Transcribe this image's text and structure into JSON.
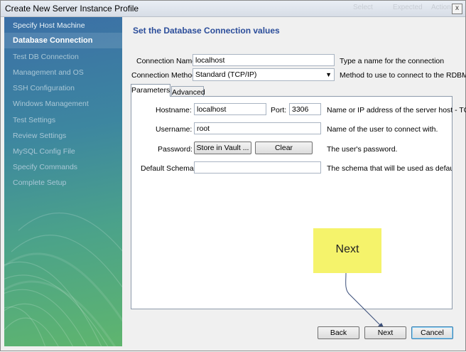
{
  "window": {
    "title": "Create New Server Instance Profile",
    "close_glyph": "x",
    "ghost_texts": [
      "Select",
      "Expected",
      "Action"
    ]
  },
  "sidebar": {
    "items": [
      {
        "label": "Specify Host Machine",
        "state": "done"
      },
      {
        "label": "Database Connection",
        "state": "active"
      },
      {
        "label": "Test DB Connection",
        "state": "pending"
      },
      {
        "label": "Management and OS",
        "state": "pending"
      },
      {
        "label": "SSH Configuration",
        "state": "pending"
      },
      {
        "label": "Windows Management",
        "state": "pending"
      },
      {
        "label": "Test Settings",
        "state": "pending"
      },
      {
        "label": "Review Settings",
        "state": "pending"
      },
      {
        "label": "MySQL Config File",
        "state": "pending"
      },
      {
        "label": "Specify Commands",
        "state": "pending"
      },
      {
        "label": "Complete Setup",
        "state": "pending"
      }
    ]
  },
  "main": {
    "heading": "Set the Database Connection values",
    "connection_name": {
      "label": "Connection Name:",
      "value": "localhost",
      "help": "Type a name for the connection"
    },
    "connection_method": {
      "label": "Connection Method:",
      "value": "Standard (TCP/IP)",
      "help": "Method to use to connect to the RDBMS"
    },
    "tabs": [
      {
        "label": "Parameters",
        "active": true
      },
      {
        "label": "Advanced",
        "active": false
      }
    ],
    "hostname": {
      "label": "Hostname:",
      "value": "localhost",
      "help": "Name or IP address of the server host - TCP"
    },
    "port": {
      "label": "Port:",
      "value": "3306"
    },
    "username": {
      "label": "Username:",
      "value": "root",
      "help": "Name of the user to connect with."
    },
    "password": {
      "label": "Password:",
      "store_button": "Store in Vault ...",
      "clear_button": "Clear",
      "help": "The user's password."
    },
    "default_schema": {
      "label": "Default Schema:",
      "value": "",
      "help": "The schema that will be used as default sche"
    }
  },
  "callout": {
    "text": "Next",
    "color": "#f5f36b"
  },
  "footer": {
    "back": "Back",
    "next": "Next",
    "cancel": "Cancel"
  },
  "colors": {
    "heading": "#2b4d9a",
    "sidebar_top": "#3b6fa6",
    "sidebar_bottom": "#5fb56e"
  }
}
